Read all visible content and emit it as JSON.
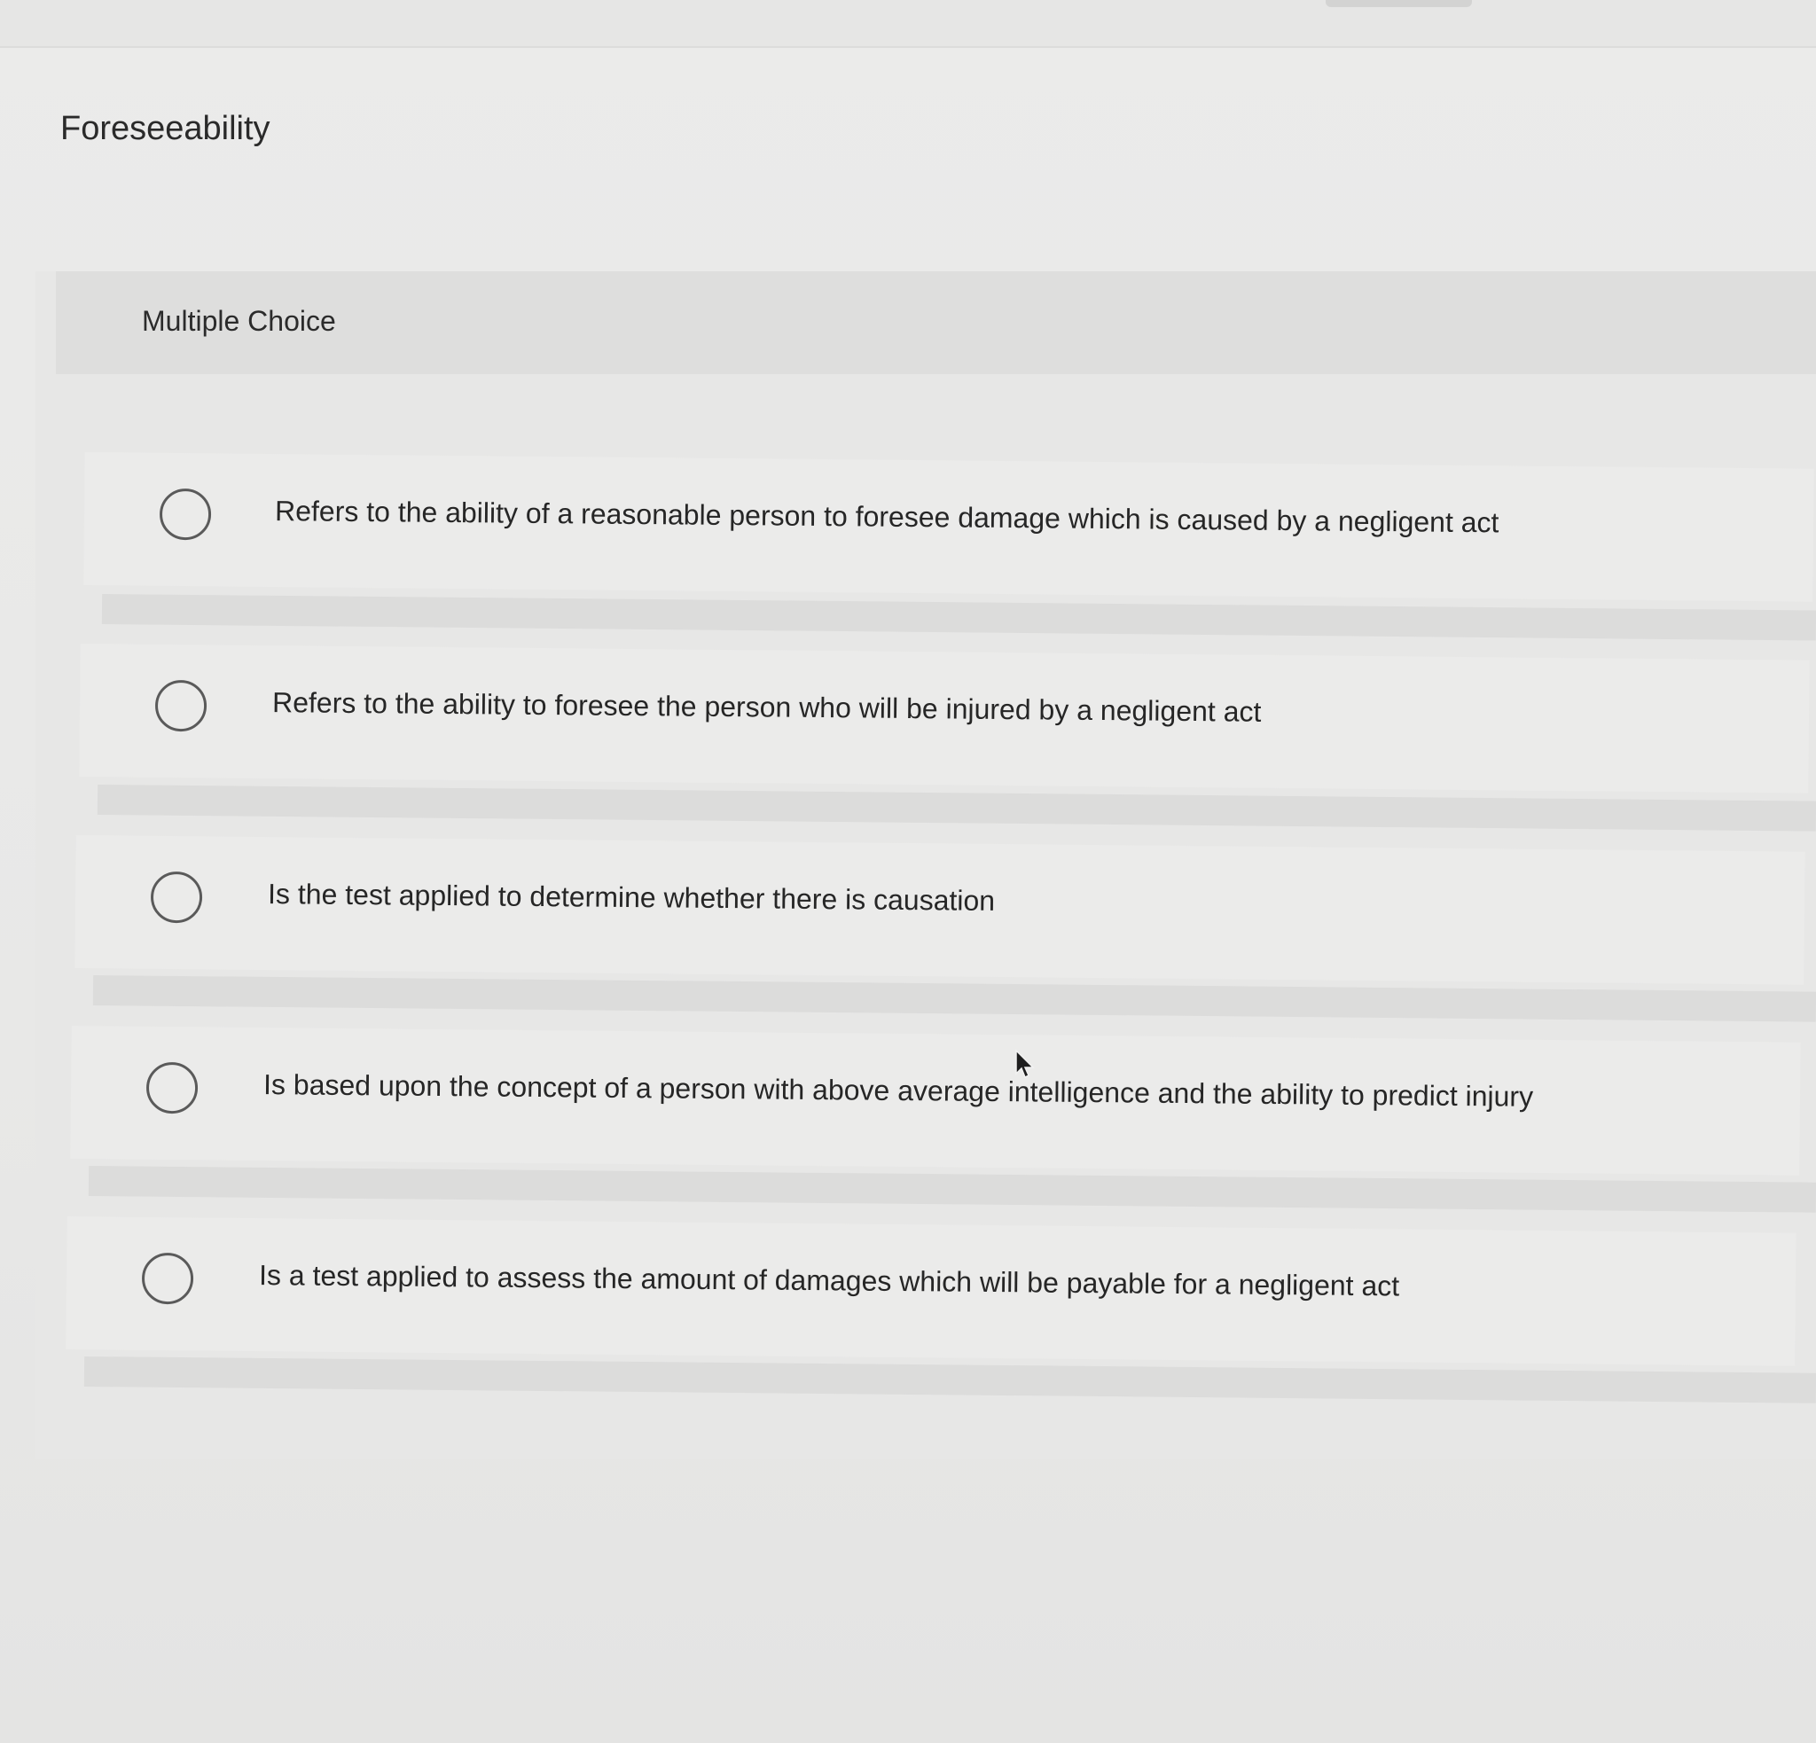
{
  "question": {
    "title": "Foreseeability",
    "type_label": "Multiple Choice"
  },
  "options": [
    {
      "label": "Refers to the ability of a reasonable person to foresee damage which is caused by a negligent act",
      "selected": false
    },
    {
      "label": "Refers to the ability to foresee the person who will be injured by a negligent act",
      "selected": false
    },
    {
      "label": "Is the test applied to determine whether there is causation",
      "selected": false
    },
    {
      "label": "Is based upon the concept of a person with above average intelligence and the ability to predict injury",
      "selected": false
    },
    {
      "label": "Is a test applied to assess the amount of damages which will be payable for a negligent act",
      "selected": false
    }
  ],
  "colors": {
    "background": "#ececeb",
    "type_bar": "#dededd",
    "radio_border": "#5a5a5a",
    "text": "#262626"
  },
  "icons": {
    "radio": "radio-button-unselected-icon",
    "cursor": "mouse-pointer-icon"
  }
}
